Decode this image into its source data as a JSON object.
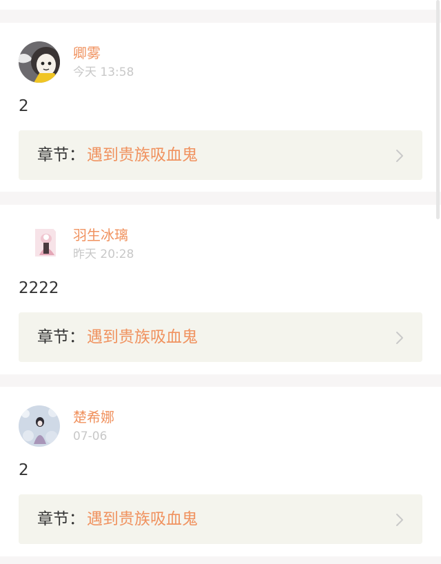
{
  "comments": [
    {
      "username": "卿雾",
      "time": "今天 13:58",
      "text": "2",
      "chapter_label": "章节：",
      "chapter_title": "遇到贵族吸血鬼",
      "avatar_icon": "cartoon-girl-avatar"
    },
    {
      "username": "羽生冰璃",
      "time": "昨天 20:28",
      "text": "2222",
      "chapter_label": "章节：",
      "chapter_title": "遇到贵族吸血鬼",
      "avatar_icon": "pink-anime-avatar"
    },
    {
      "username": "楚希娜",
      "time": "07-06",
      "text": "2",
      "chapter_label": "章节：",
      "chapter_title": "遇到贵族吸血鬼",
      "avatar_icon": "snow-scene-avatar"
    }
  ],
  "colors": {
    "accent": "#f0925f",
    "timestamp": "#c8c8c8",
    "chapter_bg": "#f4f4ed",
    "divider_bg": "#f7f5f5"
  }
}
